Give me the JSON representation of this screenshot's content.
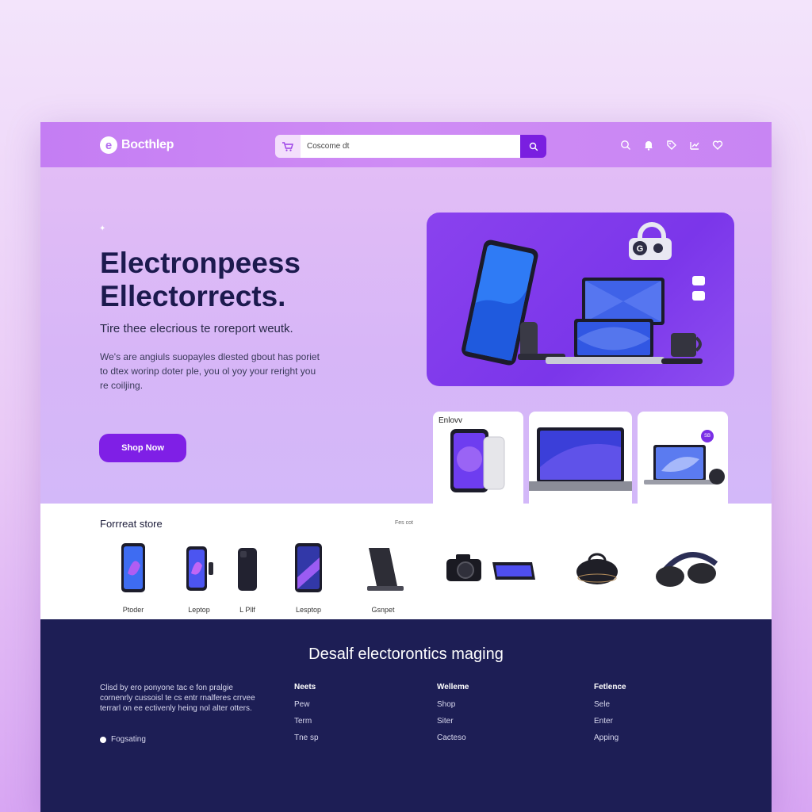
{
  "header": {
    "logo_text": "Bocthlep",
    "search": {
      "placeholder": "Coscome dt"
    },
    "icons": [
      "search-icon",
      "bell-icon",
      "tag-icon",
      "chart-icon",
      "heart-icon"
    ]
  },
  "hero": {
    "title_line1": "Electronpeess",
    "title_line2": "Ellectorrects.",
    "subtitle": "Tire thee elecrious te roreport weutk.",
    "description": "We's are angiuls suopayles dlested gbout has poriet to dtex worinp doter ple, you ol yoy your reright you re coiljing.",
    "cta_label": "Shop Now"
  },
  "product_cards": {
    "first_label": "Enlovv",
    "badge": "SB"
  },
  "store": {
    "title": "Forrreat store",
    "link": "Fes cot",
    "items": [
      {
        "label": "Ptoder"
      },
      {
        "label": "Leptop"
      },
      {
        "label": "L Pllf"
      },
      {
        "label": "Lesptop"
      },
      {
        "label": "Gsnpet"
      },
      {
        "label": ""
      },
      {
        "label": ""
      },
      {
        "label": ""
      }
    ]
  },
  "footer": {
    "title": "Desalf electorontics maging",
    "description": "Clisd by ero ponyone tac e fon pralgie cornenrly cussoisl te cs entr rnalferes crrvee terrarl on ee ectivenly heing nol alter otters.",
    "toggle_label": "Fogsating",
    "columns": [
      {
        "heading": "Neets",
        "links": [
          "Pew",
          "Term",
          "Tne sp"
        ]
      },
      {
        "heading": "Welleme",
        "links": [
          "Shop",
          "Siter",
          "Cacteso"
        ]
      },
      {
        "heading": "Fetlence",
        "links": [
          "Sele",
          "Enter",
          "Apping"
        ]
      }
    ]
  },
  "colors": {
    "accent": "#7f1fe6",
    "header_bg": "#c885f3",
    "footer_bg": "#1d1e55",
    "title_text": "#1c1a4e"
  }
}
